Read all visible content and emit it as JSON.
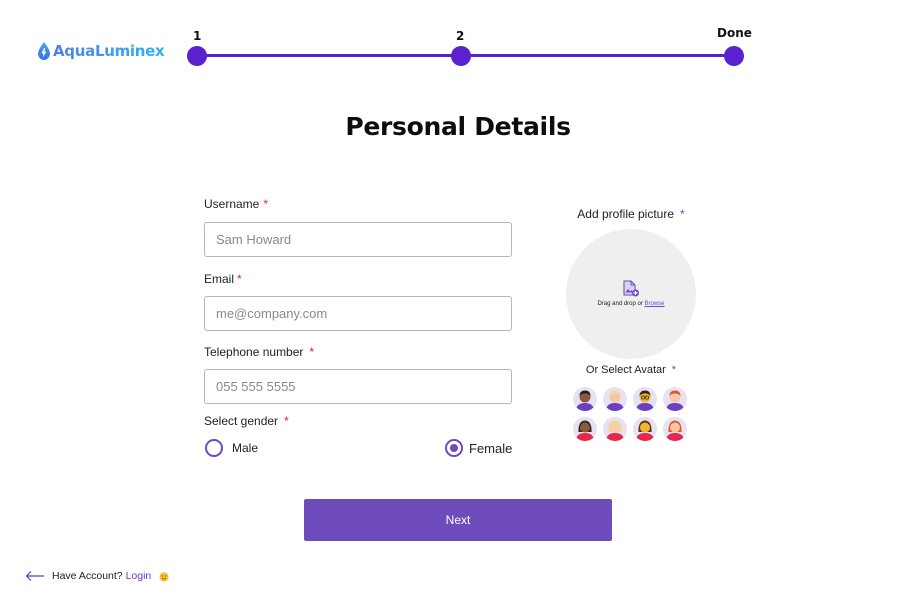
{
  "brand": {
    "name": "AquaLuminex"
  },
  "stepper": {
    "steps": [
      {
        "label": "1"
      },
      {
        "label": "2"
      },
      {
        "label": "Done"
      }
    ]
  },
  "page_title": "Personal Details",
  "form": {
    "username": {
      "label": "Username",
      "required_mark": "*",
      "placeholder": "Sam Howard",
      "value": ""
    },
    "email": {
      "label": "Email",
      "required_mark": "*",
      "placeholder": "me@company.com",
      "value": ""
    },
    "telephone": {
      "label": "Telephone number",
      "required_mark": "*",
      "placeholder": "055 555 5555",
      "value": ""
    },
    "gender": {
      "label": "Select gender",
      "required_mark": "*",
      "options": [
        {
          "label": "Male",
          "selected": false
        },
        {
          "label": "Female",
          "selected": true
        }
      ]
    }
  },
  "profile_picture": {
    "label": "Add profile picture",
    "required_mark": "*",
    "drop_text": "Drag and drop or",
    "browse_label": "Browse",
    "icon": "image-upload-icon"
  },
  "avatars": {
    "label": "Or Select Avatar",
    "required_mark": "*",
    "items": [
      {
        "icon": "male-avatar-dark-skin-icon"
      },
      {
        "icon": "male-avatar-blond-icon"
      },
      {
        "icon": "male-avatar-glasses-icon"
      },
      {
        "icon": "male-avatar-redhead-icon"
      },
      {
        "icon": "female-avatar-dark-skin-icon"
      },
      {
        "icon": "female-avatar-blonde-icon"
      },
      {
        "icon": "female-avatar-brunette-icon"
      },
      {
        "icon": "female-avatar-redhead-icon"
      }
    ]
  },
  "next_button": {
    "label": "Next"
  },
  "footer": {
    "have_account_text": "Have Account?",
    "login_label": "Login",
    "back_icon": "arrow-left-icon",
    "emoji_icon": "smiley-emoji-icon"
  },
  "colors": {
    "accent": "#5a22cc",
    "button": "#6e4cbb",
    "required": "#e02424",
    "brand_gradient_start": "#4f7fe6",
    "brand_gradient_end": "#2cb3f2"
  }
}
